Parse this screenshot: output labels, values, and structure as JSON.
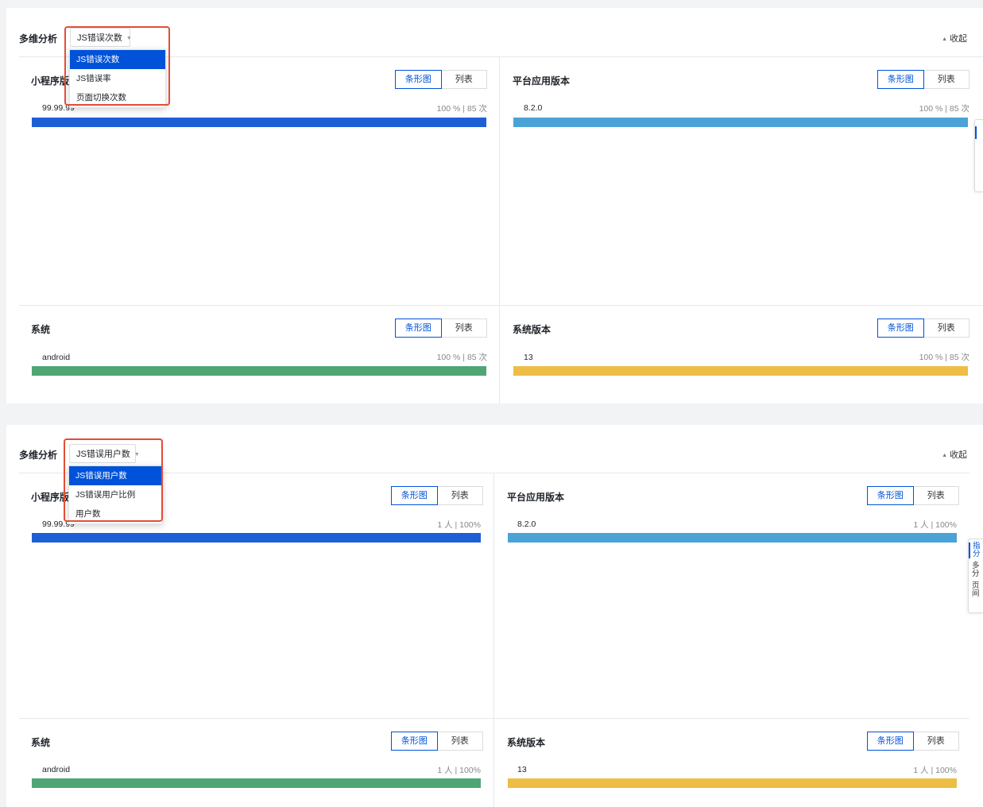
{
  "colors": {
    "accent": "#0052d9",
    "highlight": "#e34d37",
    "bar_blue": "#1e5fd6",
    "bar_light_blue": "#4ba2d6",
    "bar_green": "#50a574",
    "bar_yellow": "#edbd45"
  },
  "panel1": {
    "title": "多维分析",
    "collapse_label": "收起",
    "selected_metric": "JS错误次数",
    "dropdown_options": [
      "JS错误次数",
      "JS错误率",
      "页面切换次数"
    ],
    "quadrants": [
      {
        "title": "小程序版本",
        "bar_tab": "条形图",
        "list_tab": "列表",
        "row_label": "99.99.99",
        "row_value": "100 % | 85 次",
        "bar_color": "#1e5fd6",
        "bar_fraction": 1.0
      },
      {
        "title": "平台应用版本",
        "bar_tab": "条形图",
        "list_tab": "列表",
        "row_label": "8.2.0",
        "row_value": "100 % | 85 次",
        "bar_color": "#4ba2d6",
        "bar_fraction": 1.0
      },
      {
        "title": "系统",
        "bar_tab": "条形图",
        "list_tab": "列表",
        "row_label": "android",
        "row_value": "100 % | 85 次",
        "bar_color": "#50a574",
        "bar_fraction": 1.0
      },
      {
        "title": "系统版本",
        "bar_tab": "条形图",
        "list_tab": "列表",
        "row_label": "13",
        "row_value": "100 % | 85 次",
        "bar_color": "#edbd45",
        "bar_fraction": 1.0
      }
    ]
  },
  "panel2": {
    "title": "多维分析",
    "collapse_label": "收起",
    "selected_metric": "JS错误用户数",
    "dropdown_options": [
      "JS错误用户数",
      "JS错误用户比例",
      "用户数"
    ],
    "quadrants": [
      {
        "title": "小程序版本",
        "bar_tab": "条形图",
        "list_tab": "列表",
        "row_label": "99.99.99",
        "row_value": "1 人 | 100%",
        "bar_color": "#1e5fd6",
        "bar_fraction": 1.0
      },
      {
        "title": "平台应用版本",
        "bar_tab": "条形图",
        "list_tab": "列表",
        "row_label": "8.2.0",
        "row_value": "1 人 | 100%",
        "bar_color": "#4ba2d6",
        "bar_fraction": 1.0
      },
      {
        "title": "系统",
        "bar_tab": "条形图",
        "list_tab": "列表",
        "row_label": "android",
        "row_value": "1 人 | 100%",
        "bar_color": "#50a574",
        "bar_fraction": 1.0
      },
      {
        "title": "系统版本",
        "bar_tab": "条形图",
        "list_tab": "列表",
        "row_label": "13",
        "row_value": "1 人 | 100%",
        "bar_color": "#edbd45",
        "bar_fraction": 1.0
      }
    ],
    "side_widget_lines": [
      "指",
      "分",
      "多",
      "分",
      "页",
      "间"
    ]
  }
}
